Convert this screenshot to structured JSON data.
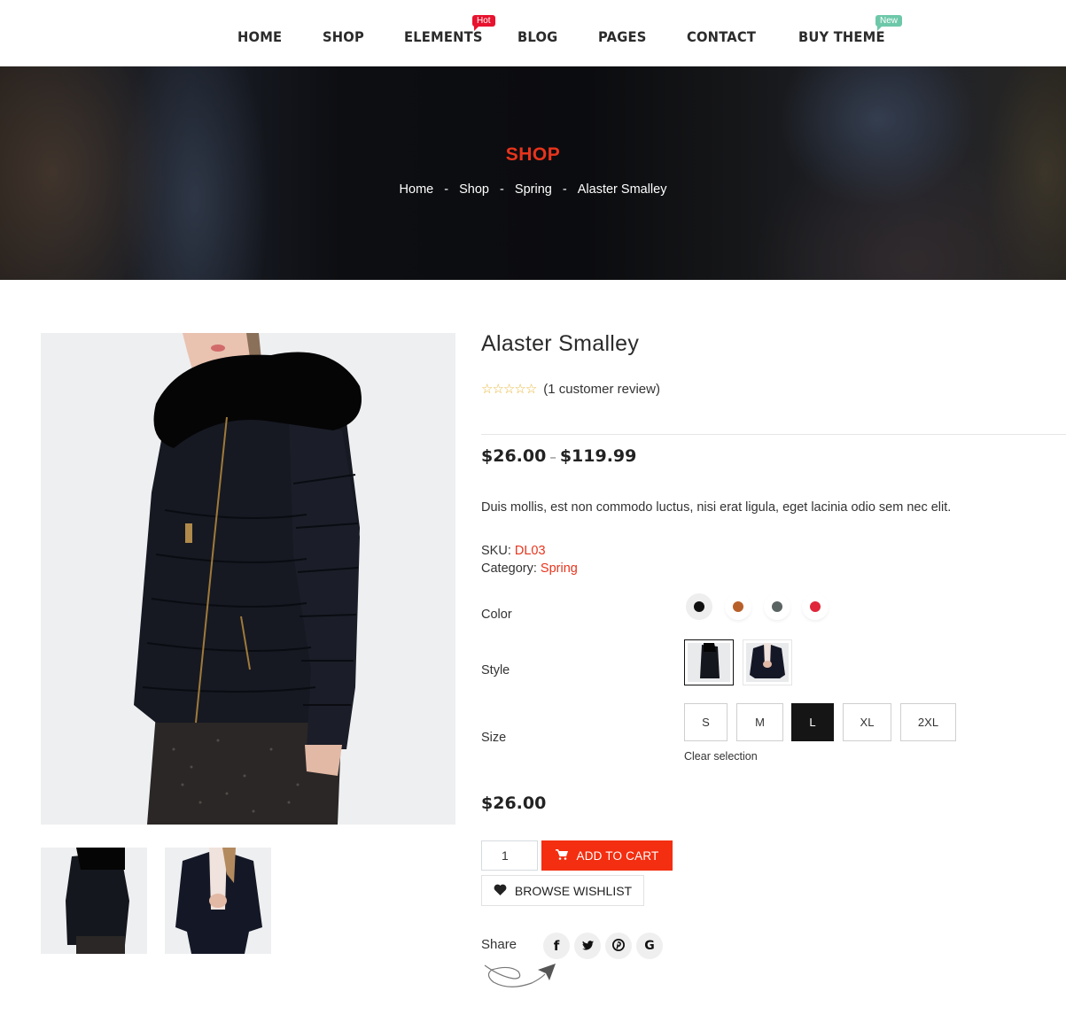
{
  "nav": {
    "items": [
      {
        "label": "HOME"
      },
      {
        "label": "SHOP"
      },
      {
        "label": "ELEMENTS",
        "badge": "Hot"
      },
      {
        "label": "BLOG"
      },
      {
        "label": "PAGES"
      },
      {
        "label": "CONTACT"
      },
      {
        "label": "BUY THEME",
        "badge": "New"
      }
    ]
  },
  "hero": {
    "title": "SHOP",
    "breadcrumb": [
      "Home",
      "Shop",
      "Spring",
      "Alaster Smalley"
    ],
    "separator": "-"
  },
  "gallery": {
    "main_image_alt": "Woman in black puffer jacket with fur hood",
    "thumbnails": [
      {
        "alt": "Black puffer jacket with fur hood"
      },
      {
        "alt": "Black fitted jacket"
      }
    ]
  },
  "product": {
    "title": "Alaster Smalley",
    "rating": {
      "stars_filled": 0,
      "stars_total": 5,
      "review_text": "(1 customer review)"
    },
    "price_min": "$26.00",
    "price_sep": "–",
    "price_max": "$119.99",
    "description": "Duis mollis, est non commodo luctus, nisi erat ligula, eget lacinia odio sem nec elit.",
    "sku_label": "SKU:",
    "sku": "DL03",
    "category_label": "Category:",
    "category": "Spring",
    "selected_price": "$26.00"
  },
  "variations": {
    "color_label": "Color",
    "style_label": "Style",
    "size_label": "Size",
    "colors": [
      {
        "name": "black",
        "hex": "#111111",
        "selected": true
      },
      {
        "name": "brown",
        "hex": "#b8602a",
        "selected": false
      },
      {
        "name": "gray",
        "hex": "#5a6463",
        "selected": false
      },
      {
        "name": "red",
        "hex": "#e0263a",
        "selected": false
      }
    ],
    "styles": [
      {
        "name": "puffer",
        "selected": true
      },
      {
        "name": "fitted",
        "selected": false
      }
    ],
    "sizes": [
      {
        "label": "S",
        "selected": false
      },
      {
        "label": "M",
        "selected": false
      },
      {
        "label": "L",
        "selected": true
      },
      {
        "label": "XL",
        "selected": false
      },
      {
        "label": "2XL",
        "selected": false
      }
    ],
    "clear_label": "Clear selection"
  },
  "cart": {
    "quantity": "1",
    "add_to_cart_label": "ADD TO CART",
    "wishlist_label": "BROWSE WISHLIST"
  },
  "share": {
    "label": "Share",
    "networks": [
      {
        "name": "facebook",
        "glyph": "f"
      },
      {
        "name": "twitter",
        "glyph": "🐦"
      },
      {
        "name": "pinterest",
        "glyph": "P"
      },
      {
        "name": "google",
        "glyph": "G"
      }
    ]
  },
  "colors": {
    "accent": "#f42e10",
    "link_red": "#e8341c",
    "star": "#e8b73a",
    "hot_badge": "#e8132e",
    "new_badge": "#6dc8a9"
  }
}
